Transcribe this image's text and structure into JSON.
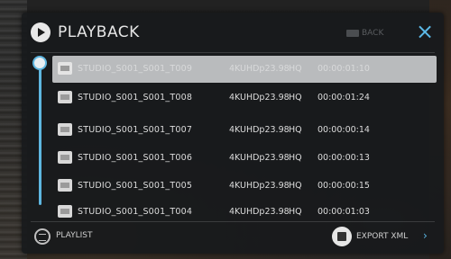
{
  "header": {
    "title": "PLAYBACK",
    "back_label": "BACK",
    "close_icon": "×"
  },
  "clips": [
    {
      "name": "STUDIO_S001_S001_T009",
      "format": "4KUHDp23.98",
      "codec": "HQ",
      "duration": "00:00:01:10"
    },
    {
      "name": "STUDIO_S001_S001_T008",
      "format": "4KUHDp23.98",
      "codec": "HQ",
      "duration": "00:00:01:24"
    },
    {
      "name": "STUDIO_S001_S001_T007",
      "format": "4KUHDp23.98",
      "codec": "HQ",
      "duration": "00:00:00:14"
    },
    {
      "name": "STUDIO_S001_S001_T006",
      "format": "4KUHDp23.98",
      "codec": "HQ",
      "duration": "00:00:00:13"
    },
    {
      "name": "STUDIO_S001_S001_T005",
      "format": "4KUHDp23.98",
      "codec": "HQ",
      "duration": "00:00:00:15"
    },
    {
      "name": "STUDIO_S001_S001_T004",
      "format": "4KUHDp23.98",
      "codec": "HQ",
      "duration": "00:00:01:03"
    }
  ],
  "footer": {
    "playlist_label": "PLAYLIST",
    "export_label": "EXPORT XML",
    "export_chevron": "›"
  },
  "colors": {
    "accent": "#5bb8e6",
    "selected_row": "#b9bbbd",
    "panel": "#181a1c"
  }
}
